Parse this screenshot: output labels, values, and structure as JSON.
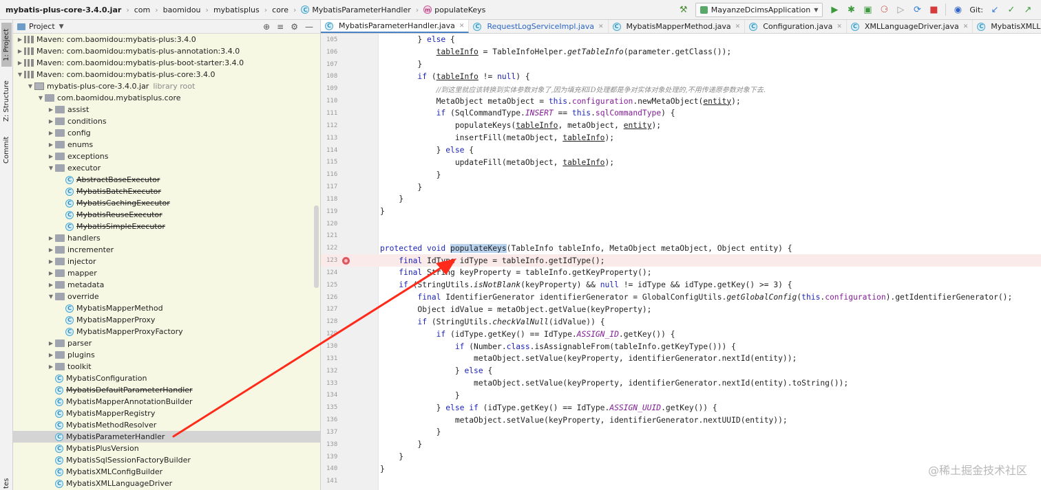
{
  "breadcrumb": {
    "items": [
      {
        "label": "mybatis-plus-core-3.4.0.jar",
        "bold": true
      },
      {
        "label": "com"
      },
      {
        "label": "baomidou"
      },
      {
        "label": "mybatisplus"
      },
      {
        "label": "core"
      },
      {
        "label": "MybatisParameterHandler",
        "icon": "class-icon"
      },
      {
        "label": "populateKeys",
        "icon": "method-icon"
      }
    ]
  },
  "toolbar": {
    "run_config": "MayanzeDcimsApplication",
    "git_label": "Git:"
  },
  "left_strip": {
    "project_tab": "1: Project",
    "structure_tab": "Z: Structure",
    "commit_tab": "Commit",
    "bottom_tab": "tes"
  },
  "project_panel": {
    "title": "Project",
    "tree": [
      {
        "label": "Maven: com.baomidou:mybatis-plus:3.4.0",
        "depth": 1,
        "kind": "lib",
        "expanded": false
      },
      {
        "label": "Maven: com.baomidou:mybatis-plus-annotation:3.4.0",
        "depth": 1,
        "kind": "lib",
        "expanded": false
      },
      {
        "label": "Maven: com.baomidou:mybatis-plus-boot-starter:3.4.0",
        "depth": 1,
        "kind": "lib",
        "expanded": false
      },
      {
        "label": "Maven: com.baomidou:mybatis-plus-core:3.4.0",
        "depth": 1,
        "kind": "lib",
        "expanded": true
      },
      {
        "label": "mybatis-plus-core-3.4.0.jar",
        "suffix": "library root",
        "depth": 2,
        "kind": "jar",
        "expanded": true
      },
      {
        "label": "com.baomidou.mybatisplus.core",
        "depth": 3,
        "kind": "pkg",
        "expanded": true
      },
      {
        "label": "assist",
        "depth": 4,
        "kind": "folder",
        "expanded": false
      },
      {
        "label": "conditions",
        "depth": 4,
        "kind": "folder",
        "expanded": false
      },
      {
        "label": "config",
        "depth": 4,
        "kind": "folder",
        "expanded": false
      },
      {
        "label": "enums",
        "depth": 4,
        "kind": "folder",
        "expanded": false
      },
      {
        "label": "exceptions",
        "depth": 4,
        "kind": "folder",
        "expanded": false
      },
      {
        "label": "executor",
        "depth": 4,
        "kind": "folder",
        "expanded": true
      },
      {
        "label": "AbstractBaseExecutor",
        "depth": 5,
        "kind": "class",
        "deprecated": true
      },
      {
        "label": "MybatisBatchExecutor",
        "depth": 5,
        "kind": "class",
        "deprecated": true
      },
      {
        "label": "MybatisCachingExecutor",
        "depth": 5,
        "kind": "class",
        "deprecated": true
      },
      {
        "label": "MybatisReuseExecutor",
        "depth": 5,
        "kind": "class",
        "deprecated": true
      },
      {
        "label": "MybatisSimpleExecutor",
        "depth": 5,
        "kind": "class",
        "deprecated": true
      },
      {
        "label": "handlers",
        "depth": 4,
        "kind": "folder",
        "expanded": false
      },
      {
        "label": "incrementer",
        "depth": 4,
        "kind": "folder",
        "expanded": false
      },
      {
        "label": "injector",
        "depth": 4,
        "kind": "folder",
        "expanded": false
      },
      {
        "label": "mapper",
        "depth": 4,
        "kind": "folder",
        "expanded": false
      },
      {
        "label": "metadata",
        "depth": 4,
        "kind": "folder",
        "expanded": false
      },
      {
        "label": "override",
        "depth": 4,
        "kind": "folder",
        "expanded": true
      },
      {
        "label": "MybatisMapperMethod",
        "depth": 5,
        "kind": "class"
      },
      {
        "label": "MybatisMapperProxy",
        "depth": 5,
        "kind": "class"
      },
      {
        "label": "MybatisMapperProxyFactory",
        "depth": 5,
        "kind": "class"
      },
      {
        "label": "parser",
        "depth": 4,
        "kind": "folder",
        "expanded": false
      },
      {
        "label": "plugins",
        "depth": 4,
        "kind": "folder",
        "expanded": false
      },
      {
        "label": "toolkit",
        "depth": 4,
        "kind": "folder",
        "expanded": false
      },
      {
        "label": "MybatisConfiguration",
        "depth": 4,
        "kind": "class"
      },
      {
        "label": "MybatisDefaultParameterHandler",
        "depth": 4,
        "kind": "class",
        "deprecated": true
      },
      {
        "label": "MybatisMapperAnnotationBuilder",
        "depth": 4,
        "kind": "class"
      },
      {
        "label": "MybatisMapperRegistry",
        "depth": 4,
        "kind": "class"
      },
      {
        "label": "MybatisMethodResolver",
        "depth": 4,
        "kind": "class"
      },
      {
        "label": "MybatisParameterHandler",
        "depth": 4,
        "kind": "class",
        "selected": true
      },
      {
        "label": "MybatisPlusVersion",
        "depth": 4,
        "kind": "class"
      },
      {
        "label": "MybatisSqlSessionFactoryBuilder",
        "depth": 4,
        "kind": "class"
      },
      {
        "label": "MybatisXMLConfigBuilder",
        "depth": 4,
        "kind": "class"
      },
      {
        "label": "MybatisXMLLanguageDriver",
        "depth": 4,
        "kind": "class"
      }
    ]
  },
  "editor": {
    "tabs": [
      {
        "label": "MybatisParameterHandler.java",
        "active": true
      },
      {
        "label": "RequestLogServiceImpl.java",
        "blue": true
      },
      {
        "label": "MybatisMapperMethod.java"
      },
      {
        "label": "Configuration.java"
      },
      {
        "label": "XMLLanguageDriver.java"
      },
      {
        "label": "MybatisXMLLanguageDriver.java"
      }
    ],
    "lines": [
      {
        "n": "105",
        "html": "        } <span class=\"kw\">else</span> {"
      },
      {
        "n": "106",
        "html": "            <span class=\"ucl\">tableInfo</span> = TableInfoHelper.<span class=\"itl\">getTableInfo</span>(parameter.getClass());"
      },
      {
        "n": "107",
        "html": "        }"
      },
      {
        "n": "108",
        "html": "        <span class=\"kw\">if</span> (<span class=\"ucl\">tableInfo</span> != <span class=\"kw\">null</span>) {"
      },
      {
        "n": "109",
        "html": "            <span class=\"cmt\">//到这里就应该转换到实体参数对象了,因为填充和ID处理都是争对实体对象处理的,不用传递原参数对象下去.</span>"
      },
      {
        "n": "110",
        "html": "            MetaObject metaObject = <span class=\"kw\">this</span>.<span class=\"fld\">configuration</span>.newMetaObject(<span class=\"ucl\">entity</span>);"
      },
      {
        "n": "111",
        "html": "            <span class=\"kw\">if</span> (SqlCommandType.<span class=\"fld itl\">INSERT</span> == <span class=\"kw\">this</span>.<span class=\"fld\">sqlCommandType</span>) {"
      },
      {
        "n": "112",
        "html": "                populateKeys(<span class=\"ucl\">tableInfo</span>, metaObject, <span class=\"ucl\">entity</span>);"
      },
      {
        "n": "113",
        "html": "                insertFill(metaObject, <span class=\"ucl\">tableInfo</span>);"
      },
      {
        "n": "114",
        "html": "            } <span class=\"kw\">else</span> {"
      },
      {
        "n": "115",
        "html": "                updateFill(metaObject, <span class=\"ucl\">tableInfo</span>);"
      },
      {
        "n": "116",
        "html": "            }"
      },
      {
        "n": "117",
        "html": "        }"
      },
      {
        "n": "118",
        "html": "    }"
      },
      {
        "n": "119",
        "html": "}"
      },
      {
        "n": "120",
        "html": ""
      },
      {
        "n": "121",
        "html": ""
      },
      {
        "n": "122",
        "html": "<span class=\"kw\">protected void</span> <span class=\"selw\">populateKeys</span>(TableInfo tableInfo, MetaObject metaObject, Object entity) {"
      },
      {
        "n": "123",
        "html": "    <span class=\"kw\">final</span> IdType idType = tableInfo.getIdType();",
        "breakpoint": true
      },
      {
        "n": "124",
        "html": "    <span class=\"kw\">final</span> String keyProperty = tableInfo.getKeyProperty();"
      },
      {
        "n": "125",
        "html": "    <span class=\"kw\">if</span> (StringUtils.<span class=\"itl\">isNotBlank</span>(keyProperty) &amp;&amp; <span class=\"kw\">null</span> != idType &amp;&amp; idType.getKey() &gt;= 3) {"
      },
      {
        "n": "126",
        "html": "        <span class=\"kw\">final</span> IdentifierGenerator identifierGenerator = GlobalConfigUtils.<span class=\"itl\">getGlobalConfig</span>(<span class=\"kw\">this</span>.<span class=\"fld\">configuration</span>).getIdentifierGenerator();"
      },
      {
        "n": "127",
        "html": "        Object idValue = metaObject.getValue(keyProperty);"
      },
      {
        "n": "128",
        "html": "        <span class=\"kw\">if</span> (StringUtils.<span class=\"itl\">checkValNull</span>(idValue)) {"
      },
      {
        "n": "129",
        "html": "            <span class=\"kw\">if</span> (idType.getKey() == IdType.<span class=\"fld itl\">ASSIGN_ID</span>.getKey()) {"
      },
      {
        "n": "130",
        "html": "                <span class=\"kw\">if</span> (Number.<span class=\"kw\">class</span>.isAssignableFrom(tableInfo.getKeyType())) {"
      },
      {
        "n": "131",
        "html": "                    metaObject.setValue(keyProperty, identifierGenerator.nextId(entity));"
      },
      {
        "n": "132",
        "html": "                } <span class=\"kw\">else</span> {"
      },
      {
        "n": "133",
        "html": "                    metaObject.setValue(keyProperty, identifierGenerator.nextId(entity).toString());"
      },
      {
        "n": "134",
        "html": "                }"
      },
      {
        "n": "135",
        "html": "            } <span class=\"kw\">else if</span> (idType.getKey() == IdType.<span class=\"fld itl\">ASSIGN_UUID</span>.getKey()) {"
      },
      {
        "n": "136",
        "html": "                metaObject.setValue(keyProperty, identifierGenerator.nextUUID(entity));"
      },
      {
        "n": "137",
        "html": "            }"
      },
      {
        "n": "138",
        "html": "        }"
      },
      {
        "n": "139",
        "html": "    }"
      },
      {
        "n": "140",
        "html": "}"
      },
      {
        "n": "141",
        "html": ""
      }
    ]
  },
  "watermark": "@稀土掘金技术社区",
  "colors": {
    "arrow": "#ff2a1a",
    "project_bg": "#f7f8e4",
    "keyword": "#1d24b8",
    "field": "#831d97",
    "breakpoint": "#db5860"
  }
}
